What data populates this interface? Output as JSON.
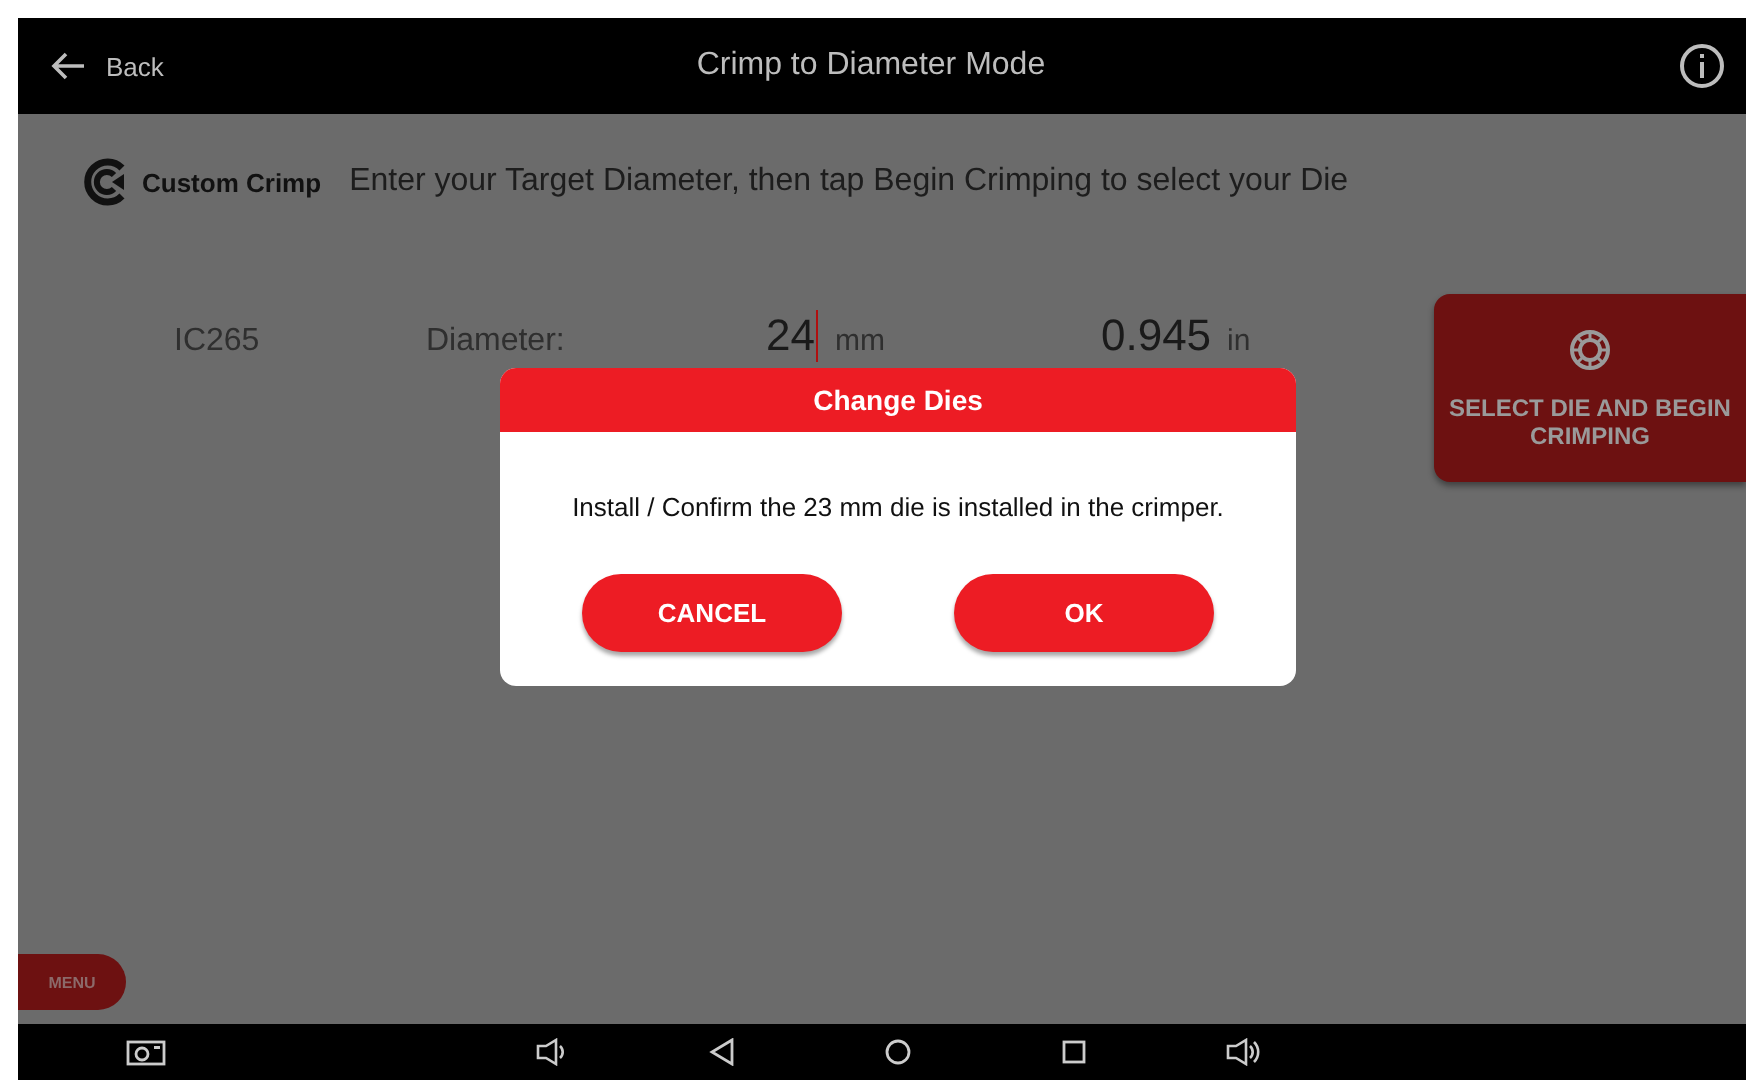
{
  "app_bar": {
    "back_label": "Back",
    "title": "Crimp to Diameter Mode"
  },
  "brand": {
    "name": "Custom Crimp"
  },
  "instruction": "Enter your Target Diameter, then tap Begin Crimping to select your Die",
  "entry": {
    "model": "IC265",
    "label": "Diameter:",
    "value_mm": "24",
    "unit_mm": "mm",
    "value_in": "0.945",
    "unit_in": "in"
  },
  "action_button": {
    "label": "SELECT DIE AND BEGIN CRIMPING"
  },
  "dialog": {
    "title": "Change Dies",
    "message": "Install / Confirm the 23 mm die is installed in the crimper.",
    "buttons": [
      "CANCEL",
      "OK"
    ]
  },
  "menu_button": {
    "label": "MENU"
  }
}
